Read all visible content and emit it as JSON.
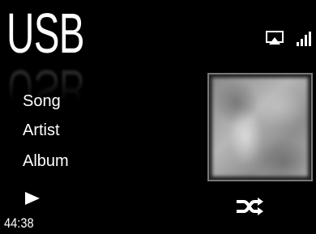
{
  "source": {
    "title": "USB"
  },
  "track": {
    "song": "Song",
    "artist": "Artist",
    "album": "Album"
  },
  "playback": {
    "elapsed_time": "44:38",
    "state_icon": "play-icon",
    "shuffle_icon": "shuffle-icon"
  },
  "status": {
    "airplay_icon": "airplay-icon",
    "signal_icon": "signal-bars-icon"
  },
  "colors": {
    "background": "#000000",
    "text": "#ffffff",
    "art_border": "#777777"
  }
}
